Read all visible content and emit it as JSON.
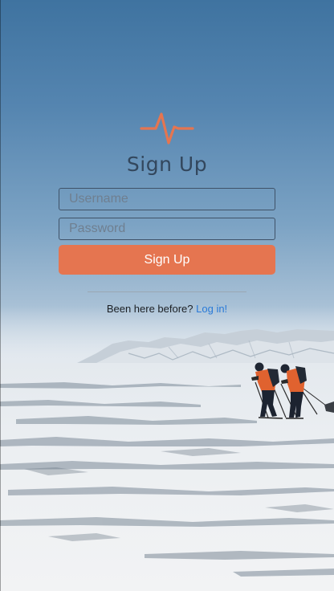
{
  "app": {
    "title": "Sign Up",
    "accent_color": "#e57550",
    "logo_icon": "heartbeat-pulse-icon"
  },
  "form": {
    "username_placeholder": "Username",
    "username_value": "",
    "password_placeholder": "Password",
    "password_value": "",
    "submit_label": "Sign Up"
  },
  "footer": {
    "prompt_text": "Been here before?",
    "login_link_label": "Log in!",
    "link_color": "#2a7ad8"
  }
}
